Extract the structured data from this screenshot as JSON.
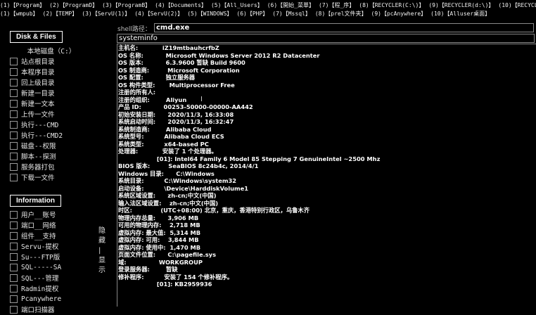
{
  "quick_row1": [
    "(1)【Program】",
    "(2)【ProgramD】",
    "(3)【ProgramB】",
    "(4)【Documents】",
    "(5)【All_Users】",
    "(6)【開始_菜單】",
    "(7)【程_序】",
    "(8)【RECYCLER(C:\\)】",
    "(9)【RECYCLER(d:\\)】",
    "(10)【RECYCLER(e:\\)】"
  ],
  "quick_row2": [
    "(1)【wmpub】",
    "(2)【TEMP】",
    "(3)【ServU(1)】",
    "(4)【ServU(2)】",
    "(5)【WINDOWS】",
    "(6)【PHP】",
    "(7)【Mssql】",
    "(8)【prel文件夹】",
    "(9)【pcAnywhere】",
    "(10)【Alluser桌面】"
  ],
  "sidebar": {
    "disk_title": "Disk & Files",
    "disk_items": [
      "本地磁盘（C:）",
      "站点根目录",
      "本程序目录",
      "回上级目录",
      "新建一目录",
      "新建一文本",
      "上传一文件",
      "执行---CMD",
      "执行---CMD2",
      "磁盘--权限",
      "脚本--探测",
      "服务器打包",
      "下载一文件"
    ],
    "info_title": "Information",
    "info_items": [
      "用户__账号",
      "端口__网络",
      "组件__支持",
      "Servu-提权",
      "Su---FTP版",
      "SQL-----SA",
      "SQL---管理",
      "Radmin提权",
      "Pcanywhere",
      "端口扫描器"
    ]
  },
  "toggle": [
    "隐",
    "藏",
    "|",
    "显",
    "示"
  ],
  "shell": {
    "label": "shell路径：",
    "value": "cmd.exe"
  },
  "command": "systeminfo",
  "output": [
    "主机名:            iZ19mtbauhcrfbZ",
    "OS 名称:           Microsoft Windows Server 2012 R2 Datacenter",
    "OS 版本:           6.3.9600 暂缺 Build 9600",
    "OS 制造商:         Microsoft Corporation",
    "OS 配置:           独立服务器",
    "OS 构件类型:       Multiprocessor Free",
    "注册的所有人:",
    "注册的组织:        Aliyun",
    "产品 ID:           00253-50000-00000-AA442",
    "初始安装日期:      2020/11/3, 16:33:08",
    "系统启动时间:      2020/11/3, 16:32:47",
    "系统制造商:        Alibaba Cloud",
    "系统型号:          Alibaba Cloud ECS",
    "系统类型:          x64-based PC",
    "处理器:            安装了 1 个处理器。",
    "                   [01]: Intel64 Family 6 Model 85 Stepping 7 GenuineIntel ~2500 Mhz",
    "BIOS 版本:         SeaBIOS 8c24b4c, 2014/4/1",
    "Windows 目录:      C:\\Windows",
    "系统目录:          C:\\Windows\\system32",
    "启动设备:          \\Device\\HarddiskVolume1",
    "系统区域设置:      zh-cn;中文(中国)",
    "输入法区域设置:    zh-cn;中文(中国)",
    "时区:              (UTC+08:00) 北京，重庆，香港特别行政区，乌鲁木齐",
    "物理内存总量:      3,906 MB",
    "可用的物理内存:    2,718 MB",
    "虚拟内存: 最大值:  5,314 MB",
    "虚拟内存: 可用:    3,844 MB",
    "虚拟内存: 使用中:  1,470 MB",
    "页面文件位置:      C:\\pagefile.sys",
    "域:                WORKGROUP",
    "登录服务器:        暂缺",
    "修补程序:          安装了 154 个修补程序。",
    "                   [01]: KB2959936"
  ]
}
